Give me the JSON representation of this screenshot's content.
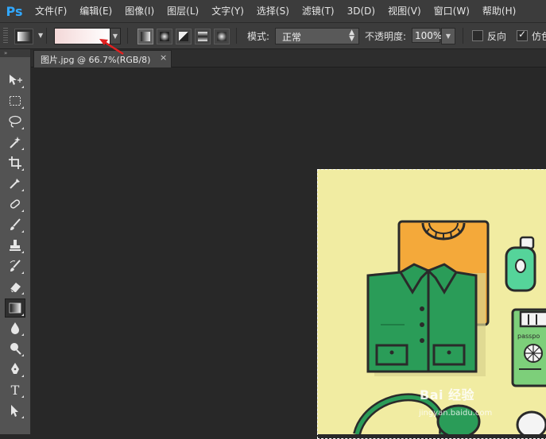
{
  "app": {
    "logo": "Ps"
  },
  "menu": [
    "文件(F)",
    "编辑(E)",
    "图像(I)",
    "图层(L)",
    "文字(Y)",
    "选择(S)",
    "滤镜(T)",
    "3D(D)",
    "视图(V)",
    "窗口(W)",
    "帮助(H)"
  ],
  "options": {
    "mode_label": "模式:",
    "mode_value": "正常",
    "opacity_label": "不透明度:",
    "opacity_value": "100%",
    "reverse_label": "反向",
    "reverse_checked": false,
    "dither_label": "仿色",
    "dither_checked": true,
    "gradient_types": [
      "linear-gradient-icon",
      "radial-gradient-icon",
      "angle-gradient-icon",
      "reflected-gradient-icon",
      "diamond-gradient-icon"
    ],
    "active_gradient_type": "linear-gradient-icon",
    "gradient_colors": [
      "#f3d8d8",
      "#ffffff"
    ]
  },
  "toolbar": {
    "header": "»",
    "tools": [
      "move-tool-icon",
      "marquee-tool-icon",
      "lasso-tool-icon",
      "magic-wand-tool-icon",
      "crop-tool-icon",
      "eyedropper-tool-icon",
      "healing-brush-tool-icon",
      "brush-tool-icon",
      "clone-stamp-tool-icon",
      "history-brush-tool-icon",
      "eraser-tool-icon",
      "gradient-tool-icon",
      "blur-tool-icon",
      "dodge-tool-icon",
      "pen-tool-icon",
      "type-tool-icon",
      "path-selection-tool-icon"
    ],
    "active_tool": "gradient-tool-icon"
  },
  "document": {
    "tab_label": "图片.jpg @ 66.7%(RGB/8)",
    "close_glyph": "×",
    "canvas_bg": "#282828",
    "image_bg": "#f1eca2"
  },
  "watermark": {
    "brand": "Bai 经验",
    "url": "jingyan.baidu.com"
  },
  "annotation": {
    "arrow_color": "#e02020"
  }
}
